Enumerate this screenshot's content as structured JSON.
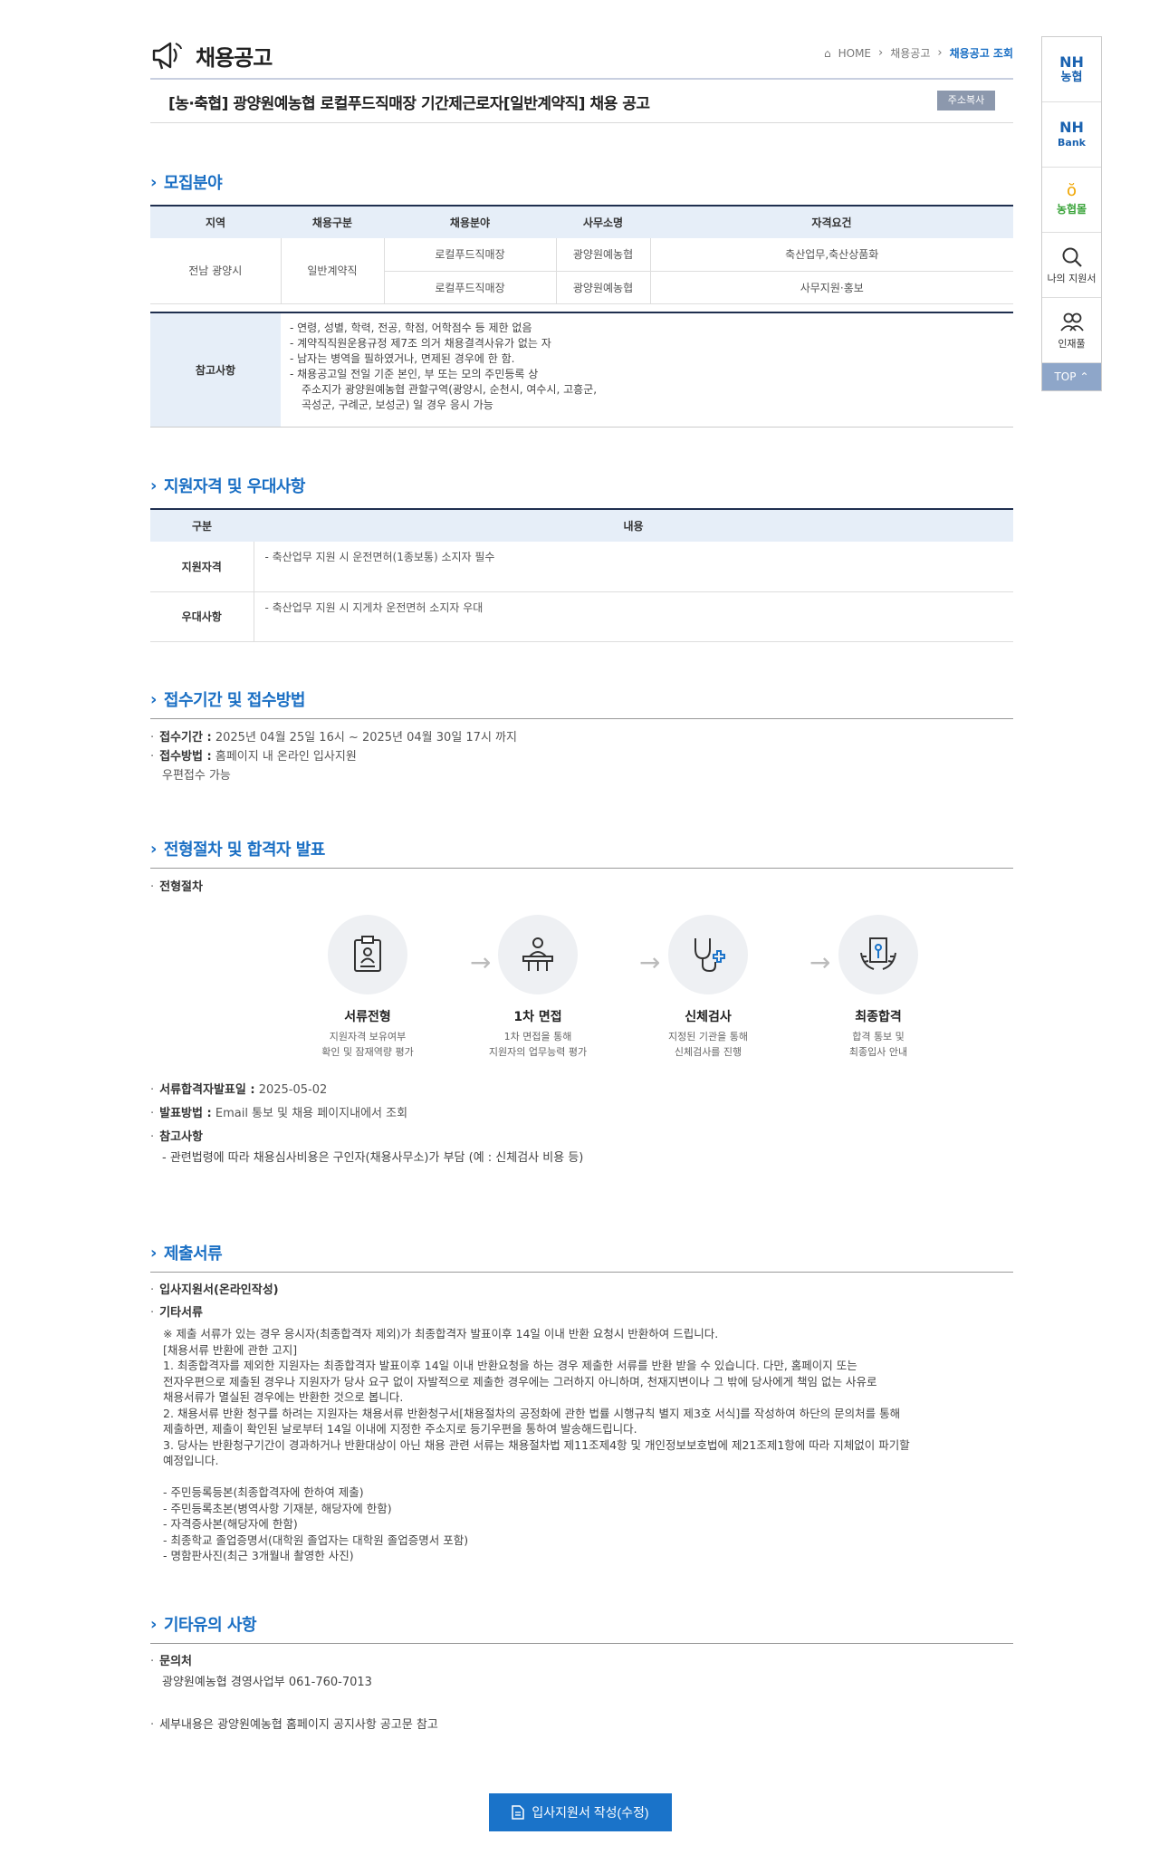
{
  "header": {
    "title": "채용공고",
    "breadcrumb": [
      "HOME",
      "채용공고",
      "채용공고 조회"
    ]
  },
  "posting": {
    "title": "[농·축협] 광양원예농협 로컬푸드직매장 기간제근로자[일반계약직] 채용 공고",
    "copy_button": "주소복사"
  },
  "recruit": {
    "heading": "모집분야",
    "columns": [
      "지역",
      "채용구분",
      "채용분야",
      "사무소명",
      "자격요건"
    ],
    "region": "전남 광양시",
    "type": "일반계약직",
    "rows": [
      {
        "field": "로컬푸드직매장",
        "office": "광양원예농협",
        "qual": "축산업무,축산상품화"
      },
      {
        "field": "로컬푸드직매장",
        "office": "광양원예농협",
        "qual": "사무지원·홍보"
      }
    ],
    "note_label": "참고사항",
    "notes": [
      "- 연령, 성별, 학력, 전공, 학점, 어학점수 등 제한 없음",
      "- 계약직직원운용규정 제7조 의거 채용결격사유가 없는 자",
      "- 남자는 병역을 필하였거나, 면제된 경우에 한 함.",
      "- 채용공고일 전일 기준 본인, 부 또는 모의 주민등록 상",
      "  주소지가 광양원예농협 관할구역(광양시, 순천시, 여수시, 고흥군,",
      "  곡성군, 구례군, 보성군) 일 경우 응시 가능"
    ]
  },
  "qualify": {
    "heading": "지원자격 및 우대사항",
    "col1": "구분",
    "col2": "내용",
    "row1_label": "지원자격",
    "row1_text": "- 축산업무 지원 시 운전면허(1종보통) 소지자 필수",
    "row2_label": "우대사항",
    "row2_text": "- 축산업무 지원 시 지게차 운전면허 소지자 우대"
  },
  "receipt": {
    "heading": "접수기간 및 접수방법",
    "period_label": "접수기간 :",
    "period": "2025년 04월 25일 16시 ~ 2025년 04월 30일 17시 까지",
    "method_label": "접수방법 :",
    "method": "홈페이지 내 온라인 입사지원",
    "method2": "우편접수 가능"
  },
  "process": {
    "heading": "전형절차 및 합격자 발표",
    "sub": "전형절차",
    "steps": [
      {
        "title": "서류전형",
        "desc1": "지원자격 보유여부",
        "desc2": "확인 및 잠재역량 평가"
      },
      {
        "title": "1차 면접",
        "desc1": "1차 면접을 통해",
        "desc2": "지원자의 업무능력 평가"
      },
      {
        "title": "신체검사",
        "desc1": "지정된 기관을 통해",
        "desc2": "신체검사를 진행"
      },
      {
        "title": "최종합격",
        "desc1": "합격 통보 및",
        "desc2": "최종입사 안내"
      }
    ],
    "announce_label": "서류합격자발표일 :",
    "announce": "2025-05-02",
    "notice_label": "발표방법 :",
    "notice": "Email 통보 및 채용 페이지내에서 조회",
    "ref_label": "참고사항",
    "ref": "- 관련법령에 따라 채용심사비용은 구인자(채용사무소)가 부담 (예 : 신체검사 비용 등)"
  },
  "documents": {
    "heading": "제출서류",
    "item1": "입사지원서(온라인작성)",
    "item2": "기타서류",
    "lines": [
      "※ 제출 서류가 있는 경우 응시자(최종합격자 제외)가 최종합격자 발표이후 14일 이내 반환 요청시 반환하여 드립니다.",
      "[채용서류 반환에 관한 고지]",
      " 1. 최종합격자를 제외한 지원자는 최종합격자 발표이후 14일 이내 반환요청을 하는 경우 제출한 서류를 반환 받을 수 있습니다. 다만, 홈페이지 또는",
      "전자우편으로 제출된 경우나 지원자가 당사 요구 없이 자발적으로 제출한 경우에는 그러하지 아니하며, 천재지변이나 그 밖에 당사에게 책임 없는 사유로",
      "채용서류가 멸실된 경우에는 반환한 것으로 봅니다.",
      " 2. 채용서류 반환 청구를 하려는 지원자는 채용서류 반환청구서[채용절차의 공정화에 관한 법률 시행규칙 별지 제3호 서식]를 작성하여 하단의 문의처를 통해",
      "제출하면, 제출이 확인된 날로부터 14일 이내에 지정한 주소지로 등기우편을 통하여 발송해드립니다.",
      " 3. 당사는 반환청구기간이 경과하거나 반환대상이 아닌 채용 관련 서류는 채용절차법 제11조제4항 및 개인정보보호법에 제21조제1항에 따라 지체없이 파기할",
      "예정입니다.",
      "",
      "- 주민등록등본(최종합격자에 한하여 제출)",
      "- 주민등록초본(병역사항 기재분, 해당자에 한함)",
      "- 자격증사본(해당자에 한함)",
      "- 최종학교 졸업증명서(대학원 졸업자는 대학원 졸업증명서 포함)",
      " - 명함판사진(최근 3개월내 촬영한 사진)"
    ]
  },
  "etc": {
    "heading": "기타유의 사항",
    "contact_label": "문의처",
    "contact": "광양원예농협 경영사업부 061-760-7013",
    "detail": "세부내용은 광양원예농협 홈페이지 공지사항 공고문 참고"
  },
  "apply_button": "입사지원서 작성(수정)",
  "quickbar": {
    "nh1": "NH",
    "nh1b": "농협",
    "nh2": "NH",
    "nh2b": "Bank",
    "mall": "농협몰",
    "my": "나의 지원서",
    "talent": "인재풀",
    "top": "TOP"
  }
}
